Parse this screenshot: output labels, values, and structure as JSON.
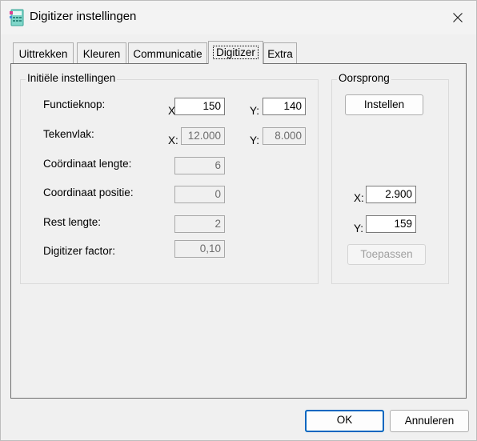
{
  "window": {
    "title": "Digitizer instellingen",
    "icon": "calculator-icon"
  },
  "tabs": [
    {
      "label": "Uittrekken",
      "active": false
    },
    {
      "label": "Kleuren",
      "active": false
    },
    {
      "label": "Communicatie",
      "active": false
    },
    {
      "label": "Digitizer",
      "active": true
    },
    {
      "label": "Extra",
      "active": false
    }
  ],
  "initial": {
    "title": "Initiële instellingen",
    "functieknop": {
      "label": "Functieknop:",
      "x_label": "X",
      "x": "150",
      "y_label": "Y:",
      "y": "140"
    },
    "tekenvlak": {
      "label": "Tekenvlak:",
      "x_label": "X:",
      "x": "12.000",
      "y_label": "Y:",
      "y": "8.000"
    },
    "coord_lengte": {
      "label": "Coördinaat lengte:",
      "value": "6"
    },
    "coord_positie": {
      "label": "Coordinaat positie:",
      "value": "0"
    },
    "rest_lengte": {
      "label": "Rest lengte:",
      "value": "2"
    },
    "digitizer_factor": {
      "label": "Digitizer factor:",
      "value": "0,10"
    }
  },
  "origin": {
    "title": "Oorsprong",
    "set_button": "Instellen",
    "x_label": "X:",
    "x": "2.900",
    "y_label": "Y:",
    "y": "159",
    "apply_button": "Toepassen"
  },
  "footer": {
    "ok": "OK",
    "cancel": "Annuleren"
  },
  "colors": {
    "accent": "#0067c0",
    "background": "#f0f0f0"
  }
}
